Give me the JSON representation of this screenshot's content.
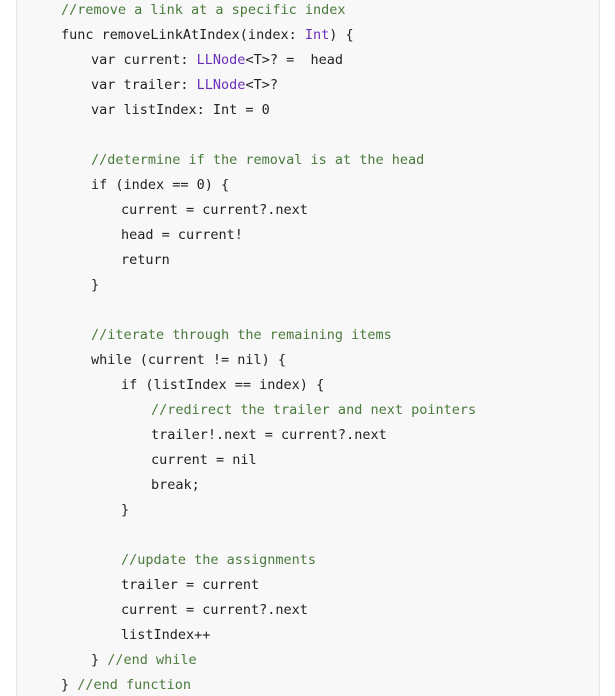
{
  "colors": {
    "background": "#ffffff",
    "code_background": "#f8f8f8",
    "text": "#222222",
    "comment": "#4a7a3c",
    "type": "#6a2fb8"
  },
  "lines": [
    {
      "indent": 0,
      "tokens": [
        {
          "kind": "comment",
          "text": "//remove a link at a specific index"
        }
      ]
    },
    {
      "indent": 0,
      "tokens": [
        {
          "kind": "plain",
          "text": "func removeLinkAtIndex(index: "
        },
        {
          "kind": "type",
          "text": "Int"
        },
        {
          "kind": "plain",
          "text": ") {"
        }
      ]
    },
    {
      "indent": 1,
      "tokens": [
        {
          "kind": "plain",
          "text": "var current: "
        },
        {
          "kind": "type",
          "text": "LLNode"
        },
        {
          "kind": "plain",
          "text": "<T>? =  head"
        }
      ]
    },
    {
      "indent": 1,
      "tokens": [
        {
          "kind": "plain",
          "text": "var trailer: "
        },
        {
          "kind": "type",
          "text": "LLNode"
        },
        {
          "kind": "plain",
          "text": "<T>?"
        }
      ]
    },
    {
      "indent": 1,
      "tokens": [
        {
          "kind": "plain",
          "text": "var listIndex: Int = 0"
        }
      ]
    },
    {
      "indent": 1,
      "tokens": []
    },
    {
      "indent": 1,
      "tokens": [
        {
          "kind": "comment",
          "text": "//determine if the removal is at the head"
        }
      ]
    },
    {
      "indent": 1,
      "tokens": [
        {
          "kind": "plain",
          "text": "if (index == 0) {"
        }
      ]
    },
    {
      "indent": 2,
      "tokens": [
        {
          "kind": "plain",
          "text": "current = current?.next"
        }
      ]
    },
    {
      "indent": 2,
      "tokens": [
        {
          "kind": "plain",
          "text": "head = current!"
        }
      ]
    },
    {
      "indent": 2,
      "tokens": [
        {
          "kind": "plain",
          "text": "return"
        }
      ]
    },
    {
      "indent": 1,
      "tokens": [
        {
          "kind": "plain",
          "text": "}"
        }
      ]
    },
    {
      "indent": 1,
      "tokens": []
    },
    {
      "indent": 1,
      "tokens": [
        {
          "kind": "comment",
          "text": "//iterate through the remaining items"
        }
      ]
    },
    {
      "indent": 1,
      "tokens": [
        {
          "kind": "plain",
          "text": "while (current != nil) {"
        }
      ]
    },
    {
      "indent": 2,
      "tokens": [
        {
          "kind": "plain",
          "text": "if (listIndex == index) {"
        }
      ]
    },
    {
      "indent": 3,
      "tokens": [
        {
          "kind": "comment",
          "text": "//redirect the trailer and next pointers"
        }
      ]
    },
    {
      "indent": 3,
      "tokens": [
        {
          "kind": "plain",
          "text": "trailer!.next = current?.next"
        }
      ]
    },
    {
      "indent": 3,
      "tokens": [
        {
          "kind": "plain",
          "text": "current = nil"
        }
      ]
    },
    {
      "indent": 3,
      "tokens": [
        {
          "kind": "plain",
          "text": "break;"
        }
      ]
    },
    {
      "indent": 2,
      "tokens": [
        {
          "kind": "plain",
          "text": "}"
        }
      ]
    },
    {
      "indent": 2,
      "tokens": []
    },
    {
      "indent": 2,
      "tokens": [
        {
          "kind": "comment",
          "text": "//update the assignments"
        }
      ]
    },
    {
      "indent": 2,
      "tokens": [
        {
          "kind": "plain",
          "text": "trailer = current"
        }
      ]
    },
    {
      "indent": 2,
      "tokens": [
        {
          "kind": "plain",
          "text": "current = current?.next"
        }
      ]
    },
    {
      "indent": 2,
      "tokens": [
        {
          "kind": "plain",
          "text": "listIndex++"
        }
      ]
    },
    {
      "indent": 1,
      "tokens": [
        {
          "kind": "plain",
          "text": "} "
        },
        {
          "kind": "comment",
          "text": "//end while"
        }
      ]
    },
    {
      "indent": 0,
      "tokens": [
        {
          "kind": "plain",
          "text": "} "
        },
        {
          "kind": "comment",
          "text": "//end function"
        }
      ]
    }
  ]
}
